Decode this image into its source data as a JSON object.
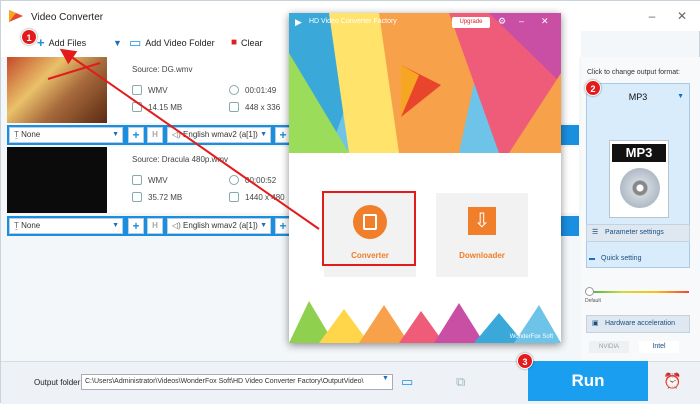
{
  "app": {
    "title": "Video Converter"
  },
  "toolbar": {
    "add_files": "Add Files",
    "add_video_folder": "Add Video Folder",
    "clear": "Clear"
  },
  "files": [
    {
      "source": "Source: DG.wmv",
      "format": "WMV",
      "duration": "00:01:49",
      "size": "14.15 MB",
      "resolution": "448 x 336",
      "subtitle": "None",
      "audio": "English wmav2 (a[1])"
    },
    {
      "source": "Source: Dracula 480p.wmv",
      "format": "WMV",
      "duration": "00:00:52",
      "size": "35.72 MB",
      "resolution": "1440 x 480",
      "subtitle": "None",
      "audio": "English wmav2 (a[1])"
    }
  ],
  "output": {
    "label": "Output folder:",
    "path": "C:\\Users\\Administrator\\Videos\\WonderFox Soft\\HD Video Converter Factory\\OutputVideo\\"
  },
  "run_label": "Run",
  "right_panel": {
    "hint": "Click to change output format:",
    "format": "MP3",
    "icon_text": "MP3",
    "parameter_settings": "Parameter settings",
    "quick_setting": "Quick setting",
    "default_label": "Default",
    "hardware_acceleration": "Hardware acceleration",
    "nvidia": "NVIDIA",
    "intel": "Intel"
  },
  "callouts": [
    "1",
    "2",
    "3"
  ],
  "hd_window": {
    "title": "HD Video Converter Factory",
    "upgrade": "Upgrade",
    "converter": "Converter",
    "downloader": "Downloader",
    "brand": "WonderFox Soft"
  },
  "colors": {
    "accent": "#1a9ef0",
    "highlight": "#e31b1b",
    "tile_orange": "#f07e2a"
  }
}
